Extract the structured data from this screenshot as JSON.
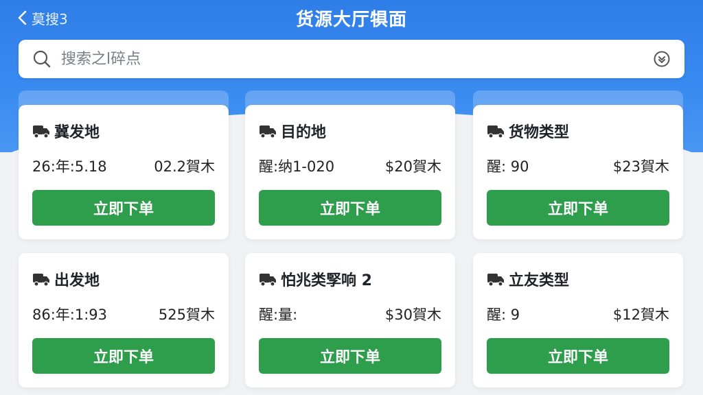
{
  "header": {
    "back_label": "莫搜3",
    "title": "货源大厅犋面"
  },
  "search": {
    "placeholder": "搜索之l碎点"
  },
  "cards": [
    {
      "title": "冀发地",
      "left": "26:年:5.18",
      "right": "02.2賀木",
      "button": "立即下单"
    },
    {
      "title": "目的地",
      "left": "醒:纳1-020",
      "right": "$20賀木",
      "button": "立即下单"
    },
    {
      "title": "货物类型",
      "left": "醒: 90",
      "right": "$23賀木",
      "button": "立即下单"
    },
    {
      "title": "出发地",
      "left": "86:年:1:93",
      "right": "525賀木",
      "button": "立即下单"
    },
    {
      "title": "怕兆类孯响 2",
      "left": "醒:量:",
      "right": "$30賀木",
      "button": "立即下单"
    },
    {
      "title": "立友类型",
      "left": "醒: 9",
      "right": "$12賀木",
      "button": "立即下单"
    }
  ],
  "colors": {
    "header_blue": "#2f7ee8",
    "button_green": "#2e9e4d",
    "card_bg": "#ffffff",
    "page_bg": "#f1f2f5"
  },
  "icons": {
    "back": "chevron-left-icon",
    "search": "search-icon",
    "scan": "scan-icon",
    "card": "truck-icon"
  }
}
